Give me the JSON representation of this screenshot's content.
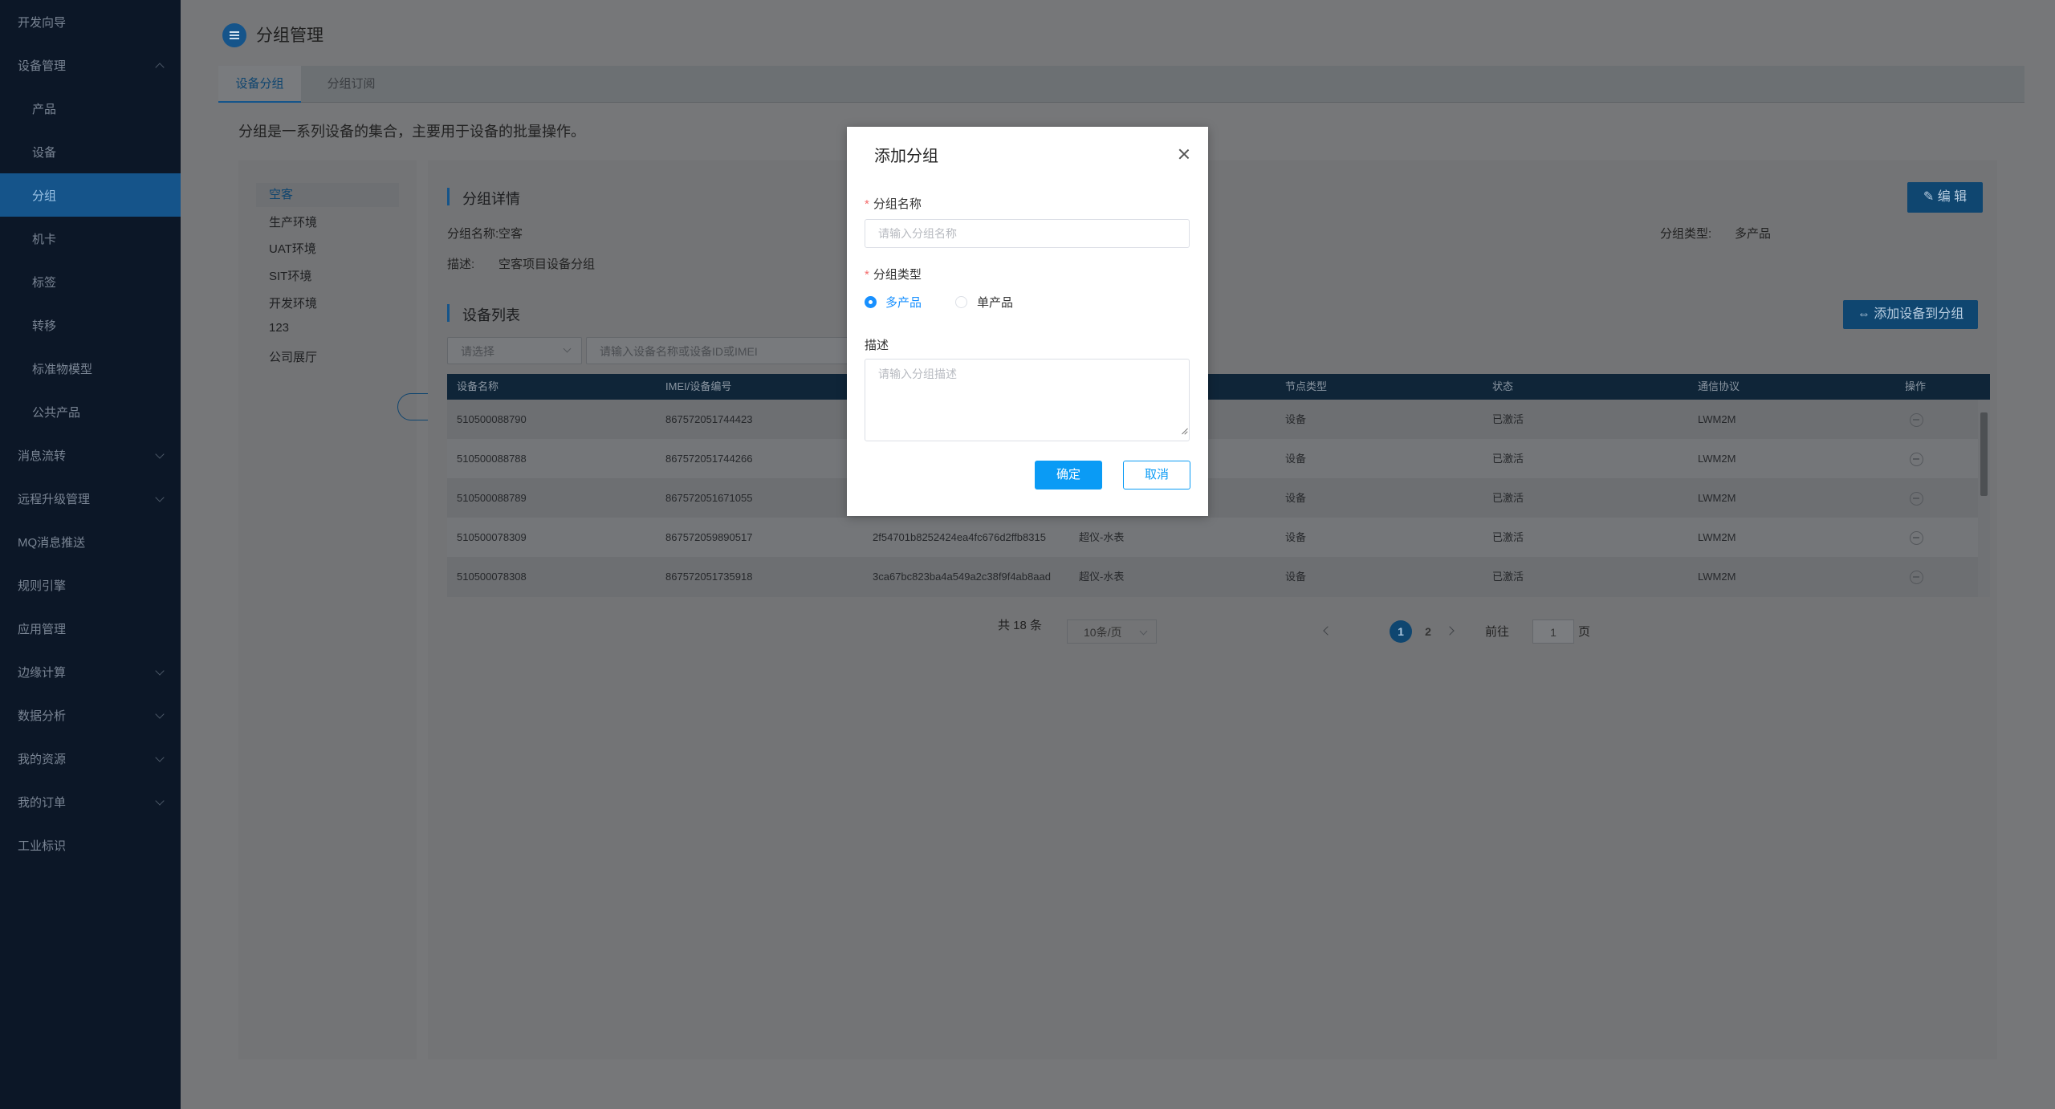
{
  "sidebar": {
    "items": [
      {
        "label": "开发向导",
        "level": "top",
        "chevron": null
      },
      {
        "label": "设备管理",
        "level": "top",
        "chevron": "up"
      },
      {
        "label": "产品",
        "level": "sub",
        "chevron": null
      },
      {
        "label": "设备",
        "level": "sub",
        "chevron": null
      },
      {
        "label": "分组",
        "level": "sub",
        "chevron": null,
        "active": true
      },
      {
        "label": "机卡",
        "level": "sub",
        "chevron": null
      },
      {
        "label": "标签",
        "level": "sub",
        "chevron": null
      },
      {
        "label": "转移",
        "level": "sub",
        "chevron": null
      },
      {
        "label": "标准物模型",
        "level": "sub",
        "chevron": null
      },
      {
        "label": "公共产品",
        "level": "sub",
        "chevron": null
      },
      {
        "label": "消息流转",
        "level": "top",
        "chevron": "down"
      },
      {
        "label": "远程升级管理",
        "level": "top",
        "chevron": "down"
      },
      {
        "label": "MQ消息推送",
        "level": "top",
        "chevron": null
      },
      {
        "label": "规则引擎",
        "level": "top",
        "chevron": null
      },
      {
        "label": "应用管理",
        "level": "top",
        "chevron": null
      },
      {
        "label": "边缘计算",
        "level": "top",
        "chevron": "down"
      },
      {
        "label": "数据分析",
        "level": "top",
        "chevron": "down"
      },
      {
        "label": "我的资源",
        "level": "top",
        "chevron": "down"
      },
      {
        "label": "我的订单",
        "level": "top",
        "chevron": "down"
      },
      {
        "label": "工业标识",
        "level": "top",
        "chevron": null
      }
    ]
  },
  "header": {
    "title": "分组管理",
    "title_icon": "menu-icon"
  },
  "tabs": [
    {
      "label": "设备分组",
      "active": true
    },
    {
      "label": "分组订阅",
      "active": false
    }
  ],
  "intro": "分组是一系列设备的集合，主要用于设备的批量操作。",
  "groups": {
    "items": [
      "空客",
      "生产环境",
      "UAT环境",
      "SIT环境",
      "开发环境",
      "123",
      "公司展厅"
    ],
    "active_index": 0,
    "add_icon": "plus-icon",
    "delete_icon": "trash-icon"
  },
  "detail": {
    "section_title": "分组详情",
    "edit_label": "编 辑",
    "edit_icon": "edit-icon",
    "name_label": "分组名称:",
    "name_value": "空客",
    "type_label": "分组类型:",
    "type_value": "多产品",
    "desc_label": "描述:",
    "desc_value": "空客项目设备分组"
  },
  "devices": {
    "section_title": "设备列表",
    "add_label": "添加设备到分组",
    "add_icon": "link-icon",
    "select_placeholder": "请选择",
    "search_placeholder": "请输入设备名称或设备ID或IMEI",
    "columns": [
      "设备名称",
      "IMEI/设备编号",
      "",
      "",
      "节点类型",
      "状态",
      "通信协议",
      "操作"
    ],
    "rows": [
      [
        "510500088790",
        "867572051744423",
        "",
        "",
        "设备",
        "已激活",
        "LWM2M"
      ],
      [
        "510500088788",
        "867572051744266",
        "",
        "",
        "设备",
        "已激活",
        "LWM2M"
      ],
      [
        "510500088789",
        "867572051671055",
        "",
        "",
        "设备",
        "已激活",
        "LWM2M"
      ],
      [
        "510500078309",
        "867572059890517",
        "2f54701b8252424ea4fc676d2ffb8315",
        "超仪-水表",
        "设备",
        "已激活",
        "LWM2M"
      ],
      [
        "510500078308",
        "867572051735918",
        "3ca67bc823ba4a549a2c38f9f4ab8aad",
        "超仪-水表",
        "设备",
        "已激活",
        "LWM2M"
      ]
    ],
    "op_icon": "minus-circle-icon"
  },
  "pagination": {
    "total": "共 18 条",
    "page_size": "10条/页",
    "pages": [
      "1",
      "2"
    ],
    "current": "1",
    "goto_prefix": "前往",
    "goto_value": "1",
    "goto_suffix": "页"
  },
  "modal": {
    "title": "添加分组",
    "name_label": "分组名称",
    "name_placeholder": "请输入分组名称",
    "type_label": "分组类型",
    "type_options": [
      "多产品",
      "单产品"
    ],
    "type_selected": "多产品",
    "desc_label": "描述",
    "desc_placeholder": "请输入分组描述",
    "ok_label": "确定",
    "cancel_label": "取消",
    "required_mark": "*"
  },
  "colors": {
    "accent": "#0a9bf5",
    "sidebar_bg": "#0c1727",
    "required": "#f56c6c"
  }
}
